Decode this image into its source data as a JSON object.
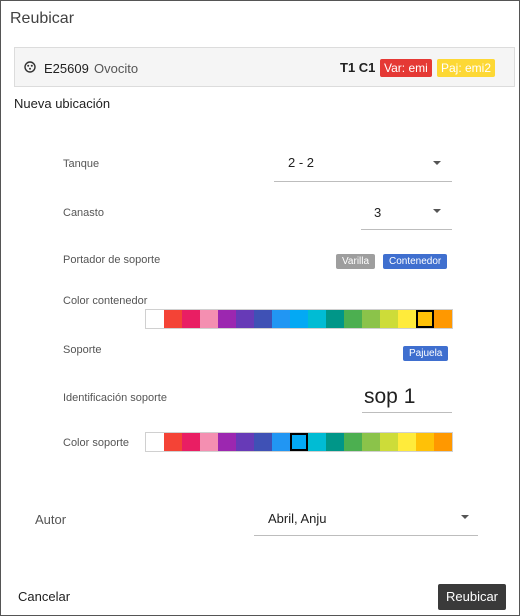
{
  "dialog": {
    "title": "Reubicar"
  },
  "sample": {
    "code": "E25609",
    "type": "Ovocito",
    "position": "T1 C1",
    "tag_var": "Var: emi",
    "tag_paj": "Paj: emi2"
  },
  "new_location": {
    "heading": "Nueva ubicación",
    "tank": {
      "label": "Tanque",
      "value": "2 - 2"
    },
    "basket": {
      "label": "Canasto",
      "value": "3"
    },
    "carrier": {
      "label": "Portador de soporte",
      "options": [
        "Varilla",
        "Contenedor"
      ],
      "selected": "Contenedor"
    },
    "container_color": {
      "label": "Color contenedor",
      "selected_index": 15
    },
    "support": {
      "label": "Soporte",
      "value": "Pajuela"
    },
    "support_id": {
      "label": "Identificación soporte",
      "value": "sop 1"
    },
    "support_color": {
      "label": "Color soporte",
      "selected_index": 8
    }
  },
  "palette_colors": [
    "#ffffff",
    "#f44336",
    "#e91e63",
    "#f48fb1",
    "#9c27b0",
    "#673ab7",
    "#3f51b5",
    "#2196f3",
    "#03a9f4",
    "#00bcd4",
    "#009688",
    "#4caf50",
    "#8bc34a",
    "#cddc39",
    "#ffeb3b",
    "#ffc107",
    "#ff9800"
  ],
  "author": {
    "label": "Autor",
    "value": "Abril, Anju"
  },
  "actions": {
    "cancel": "Cancelar",
    "confirm": "Reubicar"
  }
}
